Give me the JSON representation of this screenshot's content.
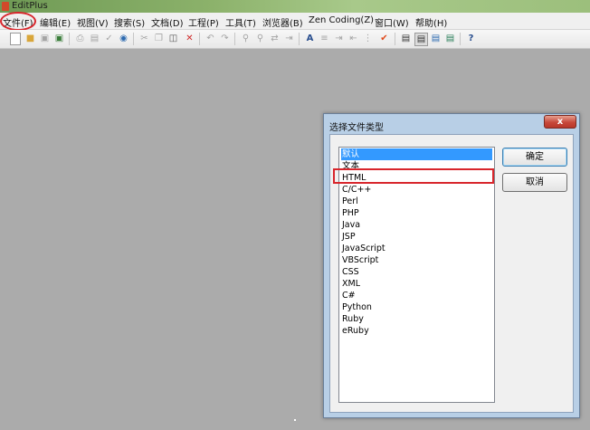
{
  "window": {
    "title": "EditPlus"
  },
  "menubar": [
    "文件(F)",
    "编辑(E)",
    "视图(V)",
    "搜索(S)",
    "文档(D)",
    "工程(P)",
    "工具(T)",
    "浏览器(B)",
    "Zen Coding(Z)",
    "窗口(W)",
    "帮助(H)"
  ],
  "dialog": {
    "title": "选择文件类型",
    "close_label": "x",
    "ok_label": "确定",
    "cancel_label": "取消",
    "file_types": [
      "默认",
      "文本",
      "HTML",
      "C/C++",
      "Perl",
      "PHP",
      "Java",
      "JSP",
      "JavaScript",
      "VBScript",
      "CSS",
      "XML",
      "C#",
      "Python",
      "Ruby",
      "eRuby"
    ],
    "selected_index": 0,
    "highlighted_item": "HTML"
  },
  "toolbar_icons": [
    "new-file-icon",
    "open-file-icon",
    "save-icon",
    "save-all-icon",
    "print-icon",
    "print-preview-icon",
    "spell-check-icon",
    "browser-preview-icon",
    "cut-icon",
    "copy-icon",
    "paste-icon",
    "delete-icon",
    "undo-icon",
    "redo-icon",
    "find-icon",
    "find-in-files-icon",
    "replace-icon",
    "goto-icon",
    "font-icon",
    "hex-icon",
    "indent-icon",
    "unindent-icon",
    "line-number-icon",
    "check-icon",
    "view-icon",
    "ruler-icon",
    "cliptext-icon",
    "directory-icon",
    "help-icon"
  ],
  "colors": {
    "accent_red": "#d8262c",
    "selection": "#3399ff"
  }
}
